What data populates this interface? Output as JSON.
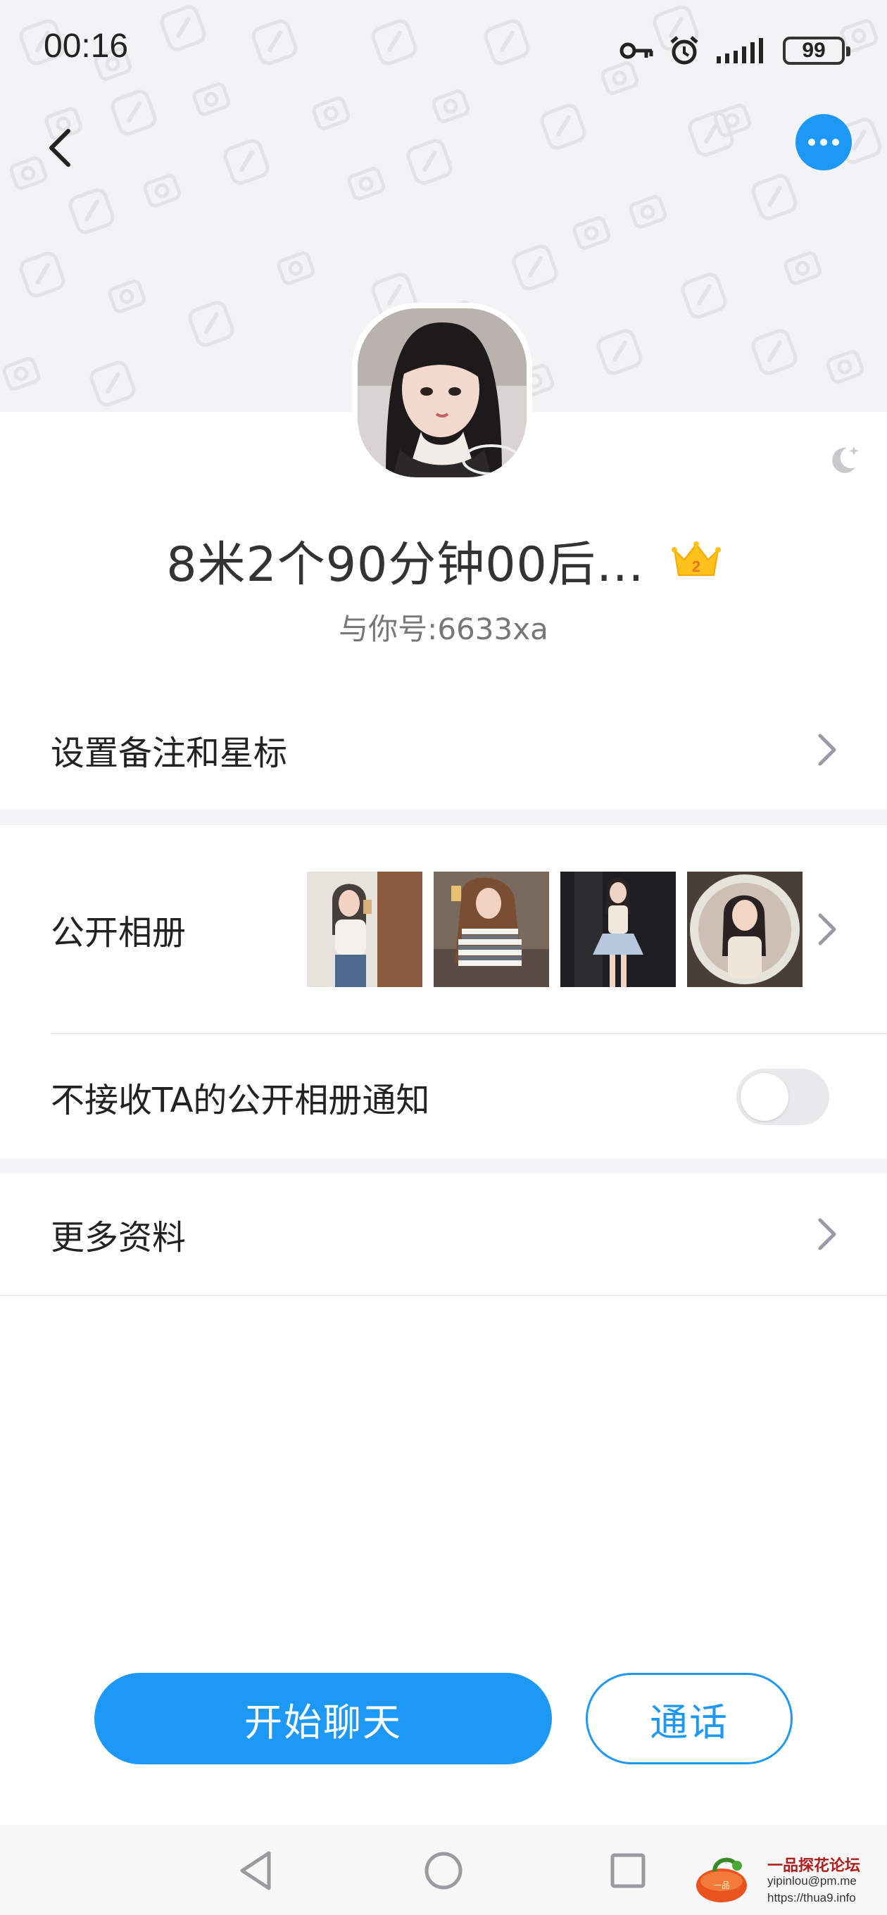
{
  "status_bar": {
    "time": "00:16",
    "battery": "99",
    "icons": [
      "key-icon",
      "alarm-icon",
      "signal-icon",
      "battery-icon"
    ]
  },
  "header": {
    "back_icon": "back-arrow-icon",
    "more_icon": "more-dots-icon",
    "accent_color": "#1e98f5"
  },
  "profile": {
    "nickname": "8米2个90分钟00后…",
    "crown_level": "2",
    "account_id": "与你号:6633xa"
  },
  "menu": {
    "remark_label": "设置备注和星标",
    "album_label": "公开相册",
    "album_notify_label": "不接收TA的公开相册通知",
    "album_notify_enabled": false,
    "more_info_label": "更多资料"
  },
  "album_photos": [
    "photo-1",
    "photo-2",
    "photo-3",
    "photo-4"
  ],
  "actions": {
    "chat_label": "开始聊天",
    "call_label": "通话"
  },
  "watermark": {
    "title": "一品探花论坛",
    "email": "yipinlou@pm.me",
    "url": "https://thua9.info"
  }
}
